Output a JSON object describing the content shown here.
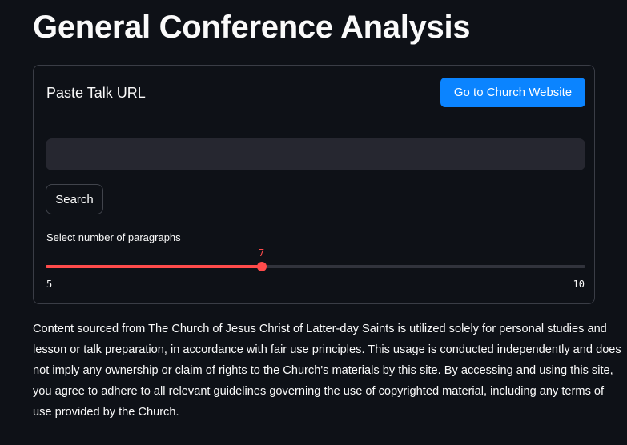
{
  "page": {
    "title": "General Conference Analysis"
  },
  "form": {
    "url_label": "Paste Talk URL",
    "website_button": "Go to Church Website",
    "url_input_value": "",
    "search_button": "Search",
    "slider": {
      "label": "Select number of paragraphs",
      "min": 5,
      "max": 10,
      "value": 7,
      "min_label": "5",
      "max_label": "10",
      "value_label": "7",
      "color": "#ff4b4b"
    }
  },
  "disclaimer": "Content sourced from The Church of Jesus Christ of Latter-day Saints is utilized solely for personal studies and lesson or talk preparation, in accordance with fair use principles. This usage is conducted independently and does not imply any ownership or claim of rights to the Church's materials by this site. By accessing and using this site, you agree to adhere to all relevant guidelines governing the use of copyrighted material, including any terms of use provided by the Church."
}
